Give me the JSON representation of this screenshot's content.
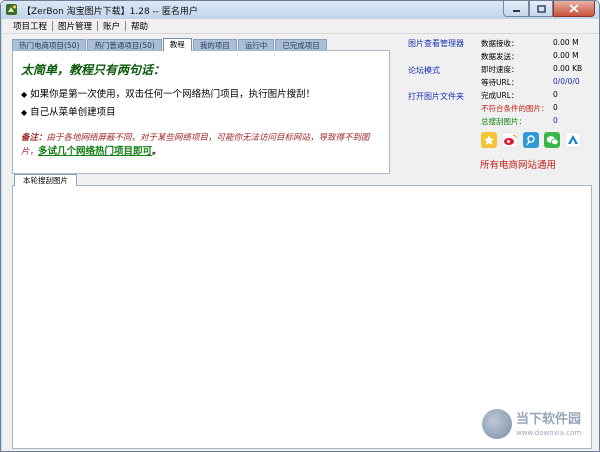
{
  "window": {
    "title": "【ZerBon 淘宝图片下载】1.28 -- 匿名用户"
  },
  "menu": [
    "项目工程",
    "图片管理",
    "账户",
    "帮助"
  ],
  "tabs": [
    {
      "label": "热门电商项目(50)",
      "active": false
    },
    {
      "label": "热门普通项目(50)",
      "active": false
    },
    {
      "label": "教程",
      "active": true
    },
    {
      "label": "我的项目",
      "active": false
    },
    {
      "label": "运行中",
      "active": false
    },
    {
      "label": "已完成项目",
      "active": false
    }
  ],
  "tutorial": {
    "headline": "太简单，教程只有两句话：",
    "bullet1": "如果你是第一次使用，双击任何一个网络热门项目，执行图片搜刮！",
    "bullet2": "自己从菜单创建项目",
    "note_label": "备注：",
    "note_text": "由于各地网络屏蔽不同，对于某些网络项目，可能你无法访问目标网站，导致得不到图片，",
    "note_link": "多试几个网络热门项目即可",
    "note_end": "。"
  },
  "links": [
    {
      "label": "图片查看管理器"
    },
    {
      "label": "论坛模式"
    },
    {
      "label": "打开图片文件夹"
    }
  ],
  "stats": [
    {
      "label": "数据接收：",
      "value": "0.00 M",
      "label_color": "#000000",
      "value_color": "#000000"
    },
    {
      "label": "数据发送：",
      "value": "0.00 M",
      "label_color": "#000000",
      "value_color": "#000000"
    },
    {
      "label": "即时速度：",
      "value": "0.00 KB",
      "label_color": "#000000",
      "value_color": "#000000"
    },
    {
      "label": "等待URL：",
      "value": "0/0/0/0",
      "label_color": "#000000",
      "value_color": "#1a2fb8"
    },
    {
      "label": "完成URL：",
      "value": "0",
      "label_color": "#000000",
      "value_color": "#000000"
    },
    {
      "label": "不符合条件的图片：",
      "value": "0",
      "label_color": "#c0201a",
      "value_color": "#000000"
    },
    {
      "label": "总搜刮图片：",
      "value": "0",
      "label_color": "#127c12",
      "value_color": "#1a2fb8"
    }
  ],
  "social_icons": [
    "qzone-icon",
    "weibo-icon",
    "qq-weibo-icon",
    "wechat-icon",
    "kaixin-icon"
  ],
  "all_sites_text": "所有电商网站通用",
  "lower_tab": "本轮搜刮图片",
  "watermark": {
    "title": "当下软件园",
    "url": "www.downxia.com"
  },
  "colors": {
    "headline": "#0c5a0c",
    "note": "#a12727",
    "link": "#1a2fb8",
    "accent_red": "#c0201a"
  }
}
